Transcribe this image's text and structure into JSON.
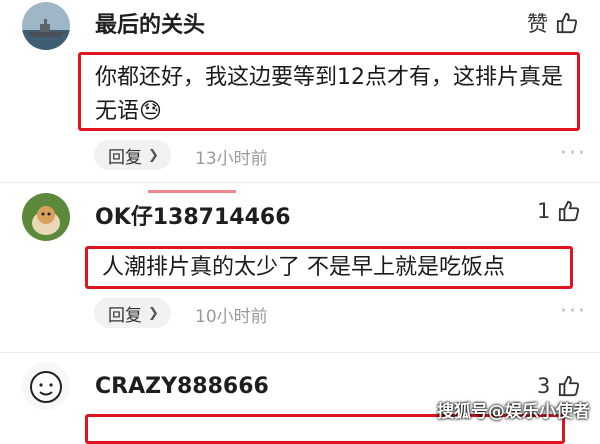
{
  "comments": [
    {
      "username": "最后的关头",
      "likes": "赞",
      "text": "你都还好，我这边要等到12点才有，这排片真是无语😓",
      "reply_label": "回复",
      "time": "13小时前",
      "avatar_icon": "warship-avatar"
    },
    {
      "username": "OK仔138714466",
      "likes": "1",
      "text": "人潮排片真的太少了 不是早上就是吃饭点",
      "reply_label": "回复",
      "time": "10小时前",
      "avatar_icon": "dog-avatar"
    },
    {
      "username": "CRAZY888666",
      "likes": "3",
      "text": "",
      "avatar_icon": "cartoon-face-avatar"
    }
  ],
  "more_icon": "more-dots-icon",
  "like_icon": "thumbs-up-icon",
  "watermark": "搜狐号@娱乐小使者",
  "colors": {
    "highlight": "#e0141e",
    "reply_bg": "#f1f1f3",
    "time": "#9b9b9b"
  }
}
